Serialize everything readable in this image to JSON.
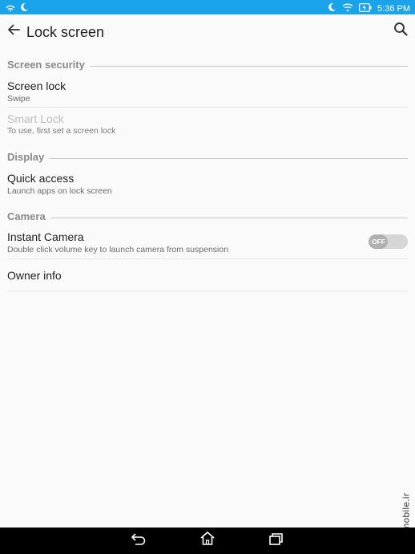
{
  "status_bar": {
    "left_icons": [
      "wifi-signal-icon",
      "night-mode-icon"
    ],
    "right_icons": [
      "night-mode-icon",
      "wifi-icon",
      "battery-charging-icon"
    ],
    "time": "5:36 PM"
  },
  "app_bar": {
    "title": "Lock screen",
    "back_icon": "arrow-back-icon",
    "search_icon": "search-icon"
  },
  "sections": {
    "screen_security": {
      "label": "Screen security",
      "screen_lock": {
        "title": "Screen lock",
        "summary": "Swipe"
      },
      "smart_lock": {
        "title": "Smart Lock",
        "summary": "To use, first set a screen lock"
      }
    },
    "display": {
      "label": "Display",
      "quick_access": {
        "title": "Quick access",
        "summary": "Launch apps on lock screen"
      }
    },
    "camera": {
      "label": "Camera",
      "instant_camera": {
        "title": "Instant Camera",
        "summary": "Double click volume key to launch camera from suspension",
        "toggle_state": "OFF"
      },
      "owner_info": {
        "title": "Owner info"
      }
    }
  },
  "watermark": "mobile.ir",
  "nav_bar": {
    "icons": [
      "back-icon",
      "home-icon",
      "recents-icon"
    ]
  }
}
